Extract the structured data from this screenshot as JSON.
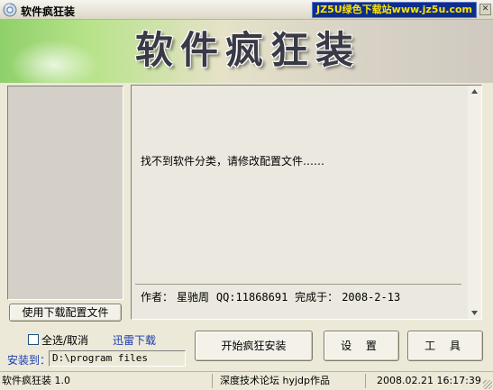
{
  "window": {
    "title": "软件疯狂装",
    "watermark": "JZ5U绿色下载站www.jz5u.com",
    "close_glyph": "✕"
  },
  "banner": {
    "title": "软件疯狂装"
  },
  "left_panel": {
    "config_button": "使用下载配置文件"
  },
  "main": {
    "message": "找不到软件分类，请修改配置文件……",
    "author_label": "作者：",
    "author_name": "星驰周",
    "qq": "QQ:11868691",
    "finished_label": "完成于：",
    "finished_date": "2008-2-13"
  },
  "controls": {
    "select_all_label": "全选/取消",
    "xunlei_link": "迅雷下载",
    "install_to_label": "安装到：",
    "install_path": "D:\\program files",
    "start_button": "开始疯狂安装",
    "settings_button": "设 置",
    "tools_button": "工 具"
  },
  "statusbar": {
    "app_version": "软件疯狂装 1.0",
    "credit": "深度技术论坛  hyjdp作品",
    "datetime": "2008.02.21    16:17:39"
  },
  "icons": {
    "app": "app-disc-icon",
    "scroll_up": "triangle-up-icon",
    "scroll_down": "triangle-down-icon"
  },
  "colors": {
    "link_blue": "#1a3ab0",
    "watermark_bg": "#0d2e8c",
    "watermark_text": "#ffe400"
  }
}
